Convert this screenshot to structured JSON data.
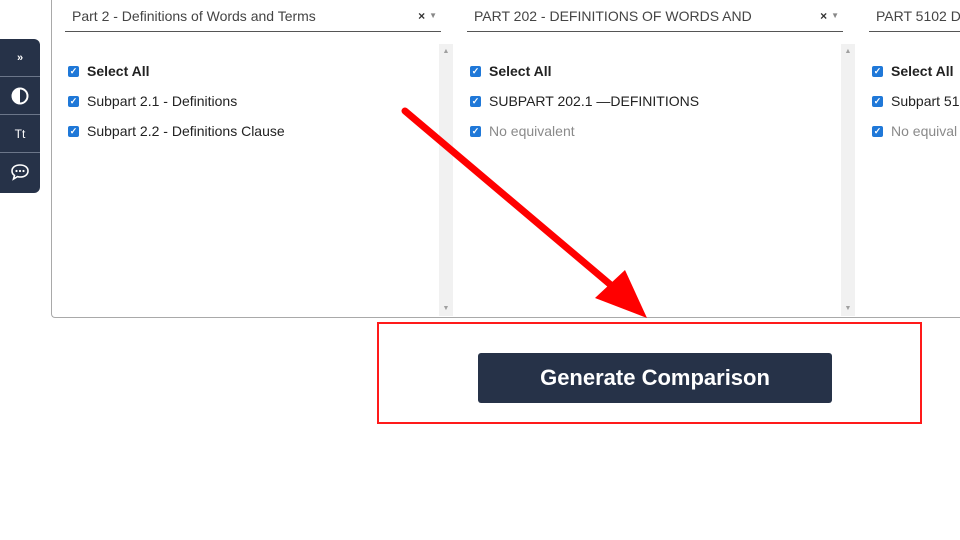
{
  "side_toolbar": {
    "items": [
      {
        "name": "expand",
        "icon": "double-chevron-right-icon",
        "glyph": "»"
      },
      {
        "name": "contrast",
        "icon": "contrast-icon",
        "glyph": ""
      },
      {
        "name": "text-size",
        "icon": "text-size-icon",
        "glyph": "Tt"
      },
      {
        "name": "feedback",
        "icon": "chat-bubble-icon",
        "glyph": ""
      }
    ]
  },
  "columns": [
    {
      "selected": "Part 2 - Definitions of Words and Terms",
      "clear_glyph": "×",
      "caret_glyph": "▼",
      "options": [
        {
          "label": "Select All",
          "checked": true,
          "style": "bold"
        },
        {
          "label": "Subpart 2.1 - Definitions",
          "checked": true,
          "style": "normal"
        },
        {
          "label": "Subpart 2.2 - Definitions Clause",
          "checked": true,
          "style": "normal"
        }
      ]
    },
    {
      "selected": "PART 202 - DEFINITIONS OF WORDS AND",
      "clear_glyph": "×",
      "caret_glyph": "▼",
      "options": [
        {
          "label": "Select All",
          "checked": true,
          "style": "bold"
        },
        {
          "label": "SUBPART 202.1 —DEFINITIONS",
          "checked": true,
          "style": "normal"
        },
        {
          "label": "No equivalent",
          "checked": true,
          "style": "muted"
        }
      ]
    },
    {
      "selected": "PART 5102 D",
      "options": [
        {
          "label": "Select All",
          "checked": true,
          "style": "bold"
        },
        {
          "label": "Subpart 51",
          "checked": true,
          "style": "normal"
        },
        {
          "label": "No equival",
          "checked": true,
          "style": "muted"
        }
      ]
    }
  ],
  "scroll": {
    "up_glyph": "▲",
    "down_glyph": "▼"
  },
  "checkbox_glyph": "✓",
  "generate_button": {
    "label": "Generate Comparison"
  },
  "annotation": {
    "color": "#ff0000",
    "type": "arrow-and-highlight-box"
  },
  "colors": {
    "navy": "#263248",
    "checkbox": "#1f78d8"
  }
}
